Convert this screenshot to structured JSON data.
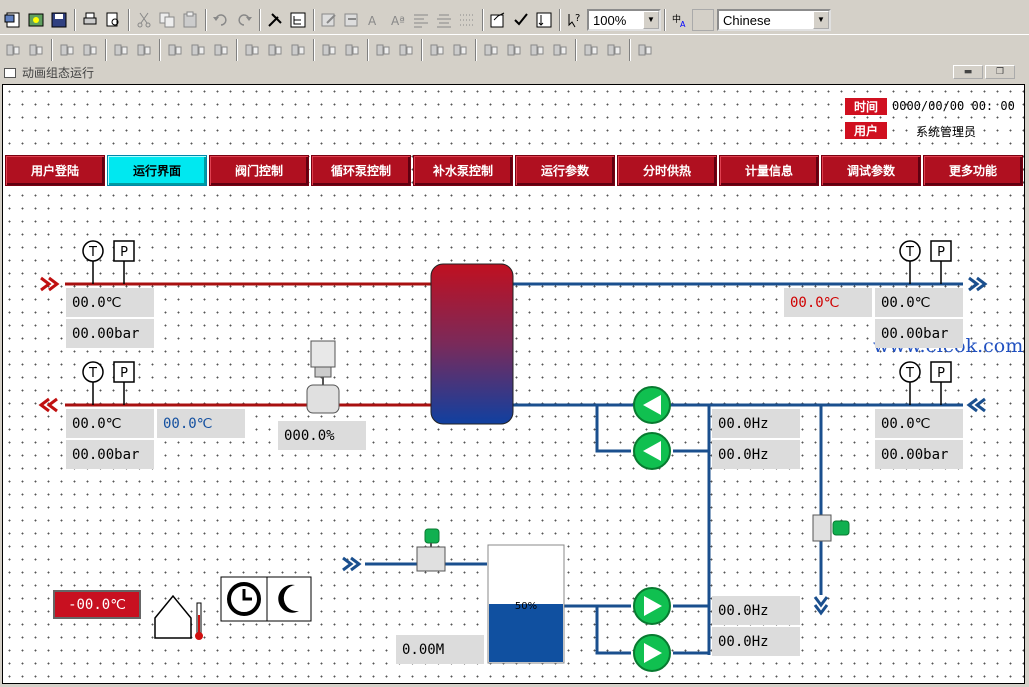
{
  "toolbar": {
    "zoom": "100%",
    "language": "Chinese"
  },
  "window": {
    "title": "动画组态运行",
    "min": "▬",
    "max": "❐"
  },
  "header": {
    "time_label": "时间",
    "time_value": "0000/00/00 00: 00",
    "user_label": "用户",
    "user_value": "系统管理员"
  },
  "nav": [
    {
      "label": "用户登陆",
      "active": false
    },
    {
      "label": "运行界面",
      "active": true
    },
    {
      "label": "阀门控制",
      "active": false
    },
    {
      "label": "循环泵控制",
      "active": false
    },
    {
      "label": "补水泵控制",
      "active": false
    },
    {
      "label": "运行参数",
      "active": false
    },
    {
      "label": "分时供热",
      "active": false
    },
    {
      "label": "计量信息",
      "active": false
    },
    {
      "label": "调试参数",
      "active": false
    },
    {
      "label": "更多功能",
      "active": false
    }
  ],
  "sensors": {
    "t_letter": "T",
    "p_letter": "P"
  },
  "primary_supply": {
    "temp": "00.0℃",
    "pressure": "00.00bar"
  },
  "primary_return": {
    "temp": "00.0℃",
    "pressure": "00.00bar",
    "temp2": "00.0℃"
  },
  "valve_opening": "000.0%",
  "secondary_supply": {
    "temp": "00.0℃",
    "pressure": "00.00bar",
    "temp_red": "00.0℃"
  },
  "secondary_return": {
    "temp": "00.0℃",
    "pressure": "00.00bar"
  },
  "circ_pumps": {
    "hz1": "00.0Hz",
    "hz2": "00.0Hz"
  },
  "makeup_pumps": {
    "hz1": "00.0Hz",
    "hz2": "00.0Hz"
  },
  "tank": {
    "level_text": "50%",
    "level": 0.5,
    "height": "0.00M"
  },
  "outdoor_temp": "-00.0℃",
  "watermark": "www.eleok.com",
  "colors": {
    "red_pipe": "#a81010",
    "blue_pipe": "#1a4f8e",
    "pump": "#10c050",
    "nav": "#b01020",
    "nav_active": "#00e8f0"
  }
}
